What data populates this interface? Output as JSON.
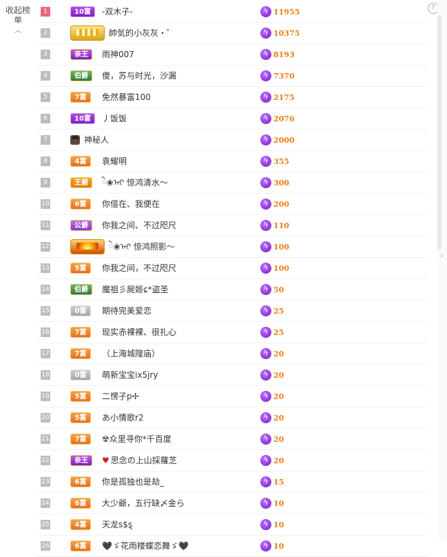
{
  "collapse": {
    "label": "收起榜单",
    "chevron_icon": "chevron-up-icon"
  },
  "help_icon": "?",
  "side_arrow_icon": "›",
  "colors": {
    "score": "#f07d14",
    "bolt": "#7a1fd0",
    "rank_first": "#e8687e"
  },
  "rows": [
    {
      "rank": "1",
      "badge": "10富",
      "badge_type": "rich-purple",
      "name": "-双木子-",
      "score": "11955"
    },
    {
      "rank": "2",
      "badge": "",
      "badge_type": "crown-gold",
      "name": "帥気的小灰灰・゜",
      "score": "10375"
    },
    {
      "rank": "3",
      "badge": "亲王",
      "badge_type": "prince",
      "name": "雨神007",
      "score": "8193"
    },
    {
      "rank": "4",
      "badge": "伯爵",
      "badge_type": "count",
      "name": "傻，苏与时光，沙漏",
      "score": "7370"
    },
    {
      "rank": "5",
      "badge": "7富",
      "badge_type": "rich",
      "name": "免然暴富100",
      "score": "2175"
    },
    {
      "rank": "6",
      "badge": "10富",
      "badge_type": "rich-purple",
      "name": "丿饭饭",
      "score": "2076"
    },
    {
      "rank": "7",
      "badge": "",
      "badge_type": "mystery",
      "name": "神秘人",
      "score": "2000"
    },
    {
      "rank": "8",
      "badge": "4富",
      "badge_type": "rich",
      "name": "袁耀明",
      "score": "355"
    },
    {
      "rank": "9",
      "badge": "王爵",
      "badge_type": "king",
      "name": "ེ❀ᠠᡳ 惊鸿清水～",
      "score": "300"
    },
    {
      "rank": "10",
      "badge": "6富",
      "badge_type": "rich",
      "name": "你偣在、我便在",
      "score": "200"
    },
    {
      "rank": "11",
      "badge": "公爵",
      "badge_type": "duke",
      "name": "你我之间、不过咫尺",
      "score": "110"
    },
    {
      "rank": "12",
      "badge": "",
      "badge_type": "crown-sun",
      "name": "ེ❀ᠠᡳ 惊鸿照影～",
      "score": "100"
    },
    {
      "rank": "13",
      "badge": "5富",
      "badge_type": "rich",
      "name": "你我之间，不过咫尺",
      "score": "100"
    },
    {
      "rank": "14",
      "badge": "伯爵",
      "badge_type": "count",
      "name": "魔祖彡屍姬ɕ*盗圣",
      "score": "50"
    },
    {
      "rank": "15",
      "badge": "0富",
      "badge_type": "rich-gray",
      "name": "期待完美爱恋",
      "score": "25"
    },
    {
      "rank": "16",
      "badge": "7富",
      "badge_type": "rich",
      "name": "现实赤裸裸、很扎心",
      "score": "25"
    },
    {
      "rank": "17",
      "badge": "7富",
      "badge_type": "rich",
      "name": "（上海城隍庙）",
      "score": "20"
    },
    {
      "rank": "18",
      "badge": "0富",
      "badge_type": "rich-gray",
      "name": "萌新宝宝ix5jry",
      "score": "20"
    },
    {
      "rank": "19",
      "badge": "5富",
      "badge_type": "rich",
      "name": "二愣子p✢",
      "score": "20"
    },
    {
      "rank": "20",
      "badge": "5富",
      "badge_type": "rich",
      "name": "あ小情歌r2",
      "score": "20"
    },
    {
      "rank": "21",
      "badge": "7富",
      "badge_type": "rich",
      "name": "☢众里寻你*千百度",
      "score": "20"
    },
    {
      "rank": "22",
      "badge": "亲王",
      "badge_type": "prince",
      "name": "思念の上山採蘿芝",
      "heart": true,
      "score": "20"
    },
    {
      "rank": "23",
      "badge": "6富",
      "badge_type": "rich",
      "name": "你是孤独也是劫_",
      "score": "15"
    },
    {
      "rank": "24",
      "badge": "6富",
      "badge_type": "rich",
      "name": "大少爺，五行缺〆金ら",
      "score": "10"
    },
    {
      "rank": "25",
      "badge": "4富",
      "badge_type": "rich",
      "name": "天龙s$ȿ",
      "score": "10"
    },
    {
      "rank": "26",
      "badge": "6富",
      "badge_type": "rich",
      "name": "🖤ゞ花雨楼蝶恋舞ゞ🖤",
      "score": "10"
    }
  ]
}
